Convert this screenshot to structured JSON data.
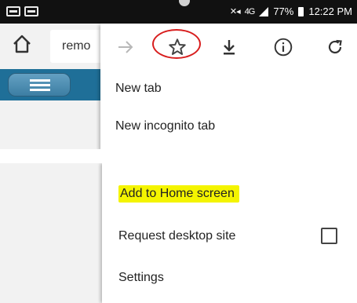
{
  "status_bar": {
    "signal_text": "4G",
    "battery": "77%",
    "time": "12:22 PM"
  },
  "browser": {
    "url_text": "remo",
    "home_icon": "home-icon",
    "page_menu_icon": "hamburger-icon"
  },
  "menu": {
    "icon_row": [
      {
        "name": "forward",
        "icon": "arrow-right-icon",
        "enabled": false
      },
      {
        "name": "bookmark",
        "icon": "star-icon",
        "highlighted": true,
        "highlight_color": "#d81e1e"
      },
      {
        "name": "download",
        "icon": "download-icon"
      },
      {
        "name": "page-info",
        "icon": "info-icon"
      },
      {
        "name": "refresh",
        "icon": "refresh-icon"
      }
    ],
    "items_top": [
      {
        "label": "New tab"
      },
      {
        "label": "New incognito tab"
      }
    ],
    "items_bottom": [
      {
        "label": "Add to Home screen",
        "highlight": "#f4f400"
      },
      {
        "label": "Request desktop site",
        "checkbox": false
      },
      {
        "label": "Settings"
      }
    ]
  },
  "colors": {
    "accent_page": "#1f6f98",
    "highlight_yellow": "#f4f400",
    "circle_red": "#d81e1e"
  }
}
